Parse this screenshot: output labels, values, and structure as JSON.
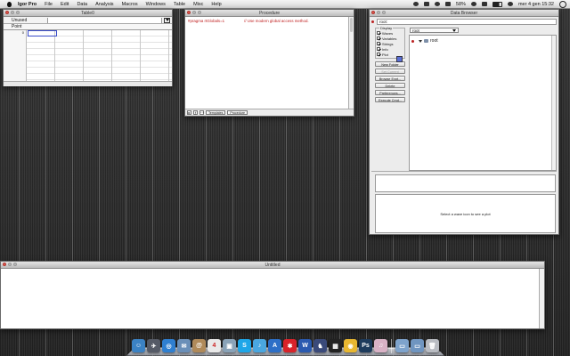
{
  "menubar": {
    "app_name": "Igor Pro",
    "items": [
      "File",
      "Edit",
      "Data",
      "Analysis",
      "Macros",
      "Windows",
      "Table",
      "Misc",
      "Help"
    ],
    "battery": "58%",
    "clock": "mer 4 gen  15:32"
  },
  "table_window": {
    "title": "Table0",
    "cell_ref": "Unused",
    "column_header": "Point",
    "row_zero": "0"
  },
  "procedure_window": {
    "title": "Procedure",
    "code_pragma": "#pragma rtGlobals=1",
    "code_comment": "// Use modern global access method.",
    "footer_buttons": [
      "▸",
      "ƒ",
      "⋯"
    ],
    "footer_popups": [
      "Templates",
      "Procedure"
    ]
  },
  "data_browser": {
    "title": "Data Browser",
    "current_folder": "root:",
    "display_group": "Display",
    "checkboxes": [
      {
        "label": "Waves",
        "checked": true
      },
      {
        "label": "Variables",
        "checked": true
      },
      {
        "label": "Strings",
        "checked": true
      },
      {
        "label": "Info",
        "checked": true
      },
      {
        "label": "Plot",
        "checked": true
      }
    ],
    "buttons": [
      {
        "label": "New Folder",
        "enabled": true
      },
      {
        "label": "Set Current",
        "enabled": false
      },
      {
        "label": "Browse Expt...",
        "enabled": true
      },
      {
        "label": "Delete",
        "enabled": true
      },
      {
        "label": "Preferences...",
        "enabled": true
      },
      {
        "label": "Execute Cmd...",
        "enabled": true
      }
    ],
    "tree_popup": "root",
    "tree_root": "root",
    "plot_placeholder": "Select a wave icon to see a plot"
  },
  "untitled_window": {
    "title": "Untitled"
  },
  "dock": {
    "icons": [
      {
        "name": "finder-icon",
        "color": "#3b82c4",
        "glyph": "☺"
      },
      {
        "name": "launchpad-icon",
        "color": "#555a66",
        "glyph": "✈"
      },
      {
        "name": "safari-icon",
        "color": "#2f7fd0",
        "glyph": "◎"
      },
      {
        "name": "mail-icon",
        "color": "#6a8fb8",
        "glyph": "✉"
      },
      {
        "name": "contacts-icon",
        "color": "#b08a5a",
        "glyph": "@"
      },
      {
        "name": "calendar-icon",
        "color": "#e9e9e9",
        "glyph": "4"
      },
      {
        "name": "preview-icon",
        "color": "#8aa3b8",
        "glyph": "▣"
      },
      {
        "name": "skype-icon",
        "color": "#1ea6e8",
        "glyph": "S"
      },
      {
        "name": "itunes-icon",
        "color": "#4aa7e0",
        "glyph": "♪"
      },
      {
        "name": "app-store-icon",
        "color": "#2d6fc7",
        "glyph": "A"
      },
      {
        "name": "mindmap-icon",
        "color": "#d8232a",
        "glyph": "✱"
      },
      {
        "name": "word-icon",
        "color": "#2a5ab0",
        "glyph": "W"
      },
      {
        "name": "igor-icon",
        "color": "#3a4a7a",
        "glyph": "♞"
      },
      {
        "name": "activity-monitor-icon",
        "color": "#222222",
        "glyph": "▦"
      },
      {
        "name": "chrome-icon",
        "color": "#e8b730",
        "glyph": "◉"
      },
      {
        "name": "photoshop-icon",
        "color": "#1d3b5c",
        "glyph": "Ps"
      },
      {
        "name": "music-app-icon",
        "color": "#d9b2c6",
        "glyph": "♫"
      },
      {
        "name": "folder-icon",
        "color": "#7ea3cc",
        "glyph": "▭"
      },
      {
        "name": "documents-icon",
        "color": "#6f95c0",
        "glyph": "▭"
      },
      {
        "name": "trash-icon",
        "color": "#b9bcc2",
        "glyph": "🗑"
      }
    ]
  }
}
